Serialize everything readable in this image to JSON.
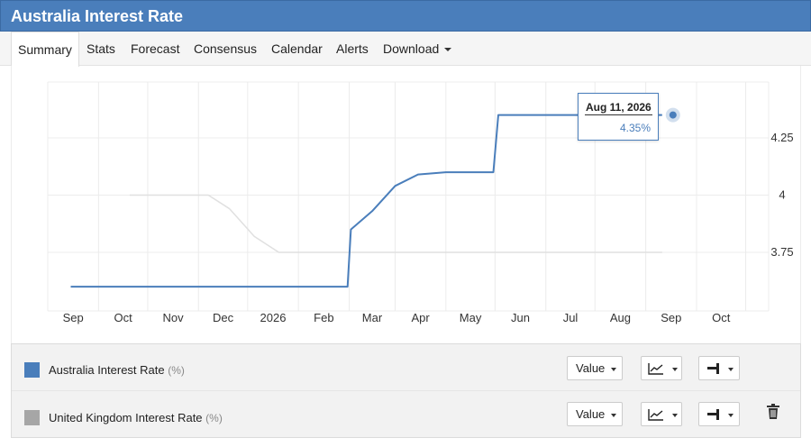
{
  "header": {
    "title": "Australia Interest Rate"
  },
  "tabs": [
    {
      "label": "Summary",
      "active": true
    },
    {
      "label": "Stats"
    },
    {
      "label": "Forecast"
    },
    {
      "label": "Consensus"
    },
    {
      "label": "Calendar"
    },
    {
      "label": "Alerts"
    },
    {
      "label": "Download",
      "dropdown": true
    }
  ],
  "tooltip": {
    "date": "Aug 11, 2026",
    "value": "4.35%"
  },
  "legend": {
    "rows": [
      {
        "name": "Australia Interest Rate",
        "unit": "(%)",
        "color": "#4a7ebb",
        "value_label": "Value"
      },
      {
        "name": "United Kingdom Interest Rate",
        "unit": "(%)",
        "color": "#a6a6a6",
        "value_label": "Value"
      }
    ]
  },
  "chart_data": {
    "type": "line",
    "x_tick_labels": [
      "Sep",
      "Oct",
      "Nov",
      "Dec",
      "2026",
      "Feb",
      "Mar",
      "Apr",
      "May",
      "Jun",
      "Jul",
      "Aug",
      "Sep",
      "Oct"
    ],
    "y_ticks": [
      3.75,
      4,
      4.25
    ],
    "y_tick_labels": [
      "3.75",
      "4",
      "4.25"
    ],
    "ylim": [
      3.5,
      4.5
    ],
    "grid": true,
    "series": [
      {
        "name": "Australia Interest Rate",
        "color": "#4a7ebb",
        "points": [
          [
            "2025-08-15",
            3.6
          ],
          [
            "2026-01-31",
            3.6
          ],
          [
            "2026-02-02",
            3.85
          ],
          [
            "2026-02-15",
            3.93
          ],
          [
            "2026-03-01",
            4.04
          ],
          [
            "2026-03-15",
            4.09
          ],
          [
            "2026-04-01",
            4.1
          ],
          [
            "2026-04-30",
            4.1
          ],
          [
            "2026-05-03",
            4.35
          ],
          [
            "2026-08-11",
            4.35
          ]
        ]
      },
      {
        "name": "United Kingdom Interest Rate",
        "color": "#e0e0e0",
        "points": [
          [
            "2025-09-20",
            4.0
          ],
          [
            "2025-11-07",
            4.0
          ],
          [
            "2025-11-20",
            3.94
          ],
          [
            "2025-12-05",
            3.82
          ],
          [
            "2025-12-20",
            3.75
          ],
          [
            "2026-08-11",
            3.75
          ]
        ]
      }
    ]
  }
}
